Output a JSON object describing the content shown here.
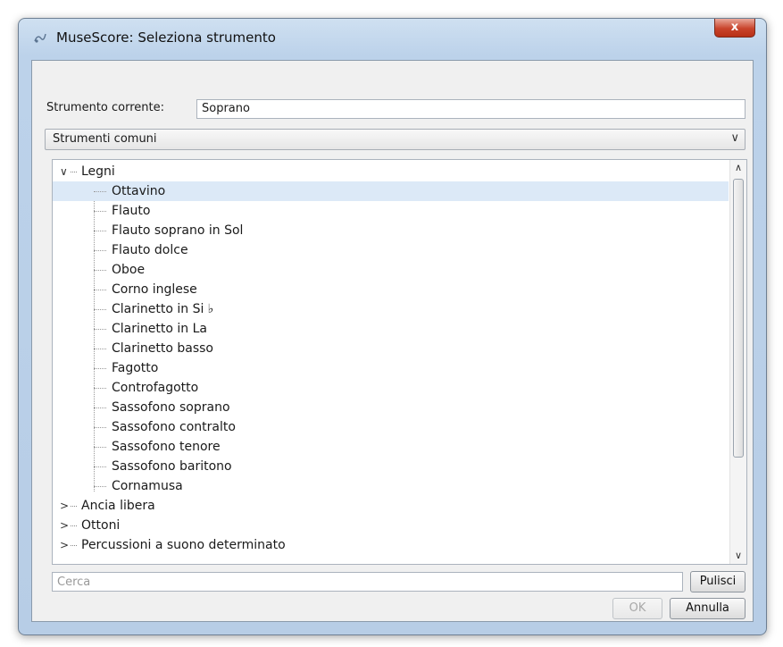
{
  "window": {
    "title": "MuseScore: Seleziona strumento",
    "close_label": "x",
    "app_icon": "musescore-icon"
  },
  "current_instrument": {
    "label": "Strumento corrente:",
    "value": "Soprano"
  },
  "filter_combo": {
    "selected": "Strumenti comuni"
  },
  "tree": {
    "groups": [
      {
        "label": "Legni",
        "expanded": true,
        "items": [
          "Ottavino",
          "Flauto",
          "Flauto soprano in Sol",
          "Flauto dolce",
          "Oboe",
          "Corno inglese",
          "Clarinetto in Si ♭",
          "Clarinetto in La",
          "Clarinetto basso",
          "Fagotto",
          "Controfagotto",
          "Sassofono soprano",
          "Sassofono contralto",
          "Sassofono tenore",
          "Sassofono baritono",
          "Cornamusa"
        ],
        "selected_item": "Ottavino"
      },
      {
        "label": "Ancia libera",
        "expanded": false
      },
      {
        "label": "Ottoni",
        "expanded": false
      },
      {
        "label": "Percussioni a suono determinato",
        "expanded": false
      }
    ]
  },
  "search": {
    "placeholder": "Cerca",
    "value": ""
  },
  "buttons": {
    "clear": "Pulisci",
    "ok": "OK",
    "cancel": "Annulla"
  }
}
